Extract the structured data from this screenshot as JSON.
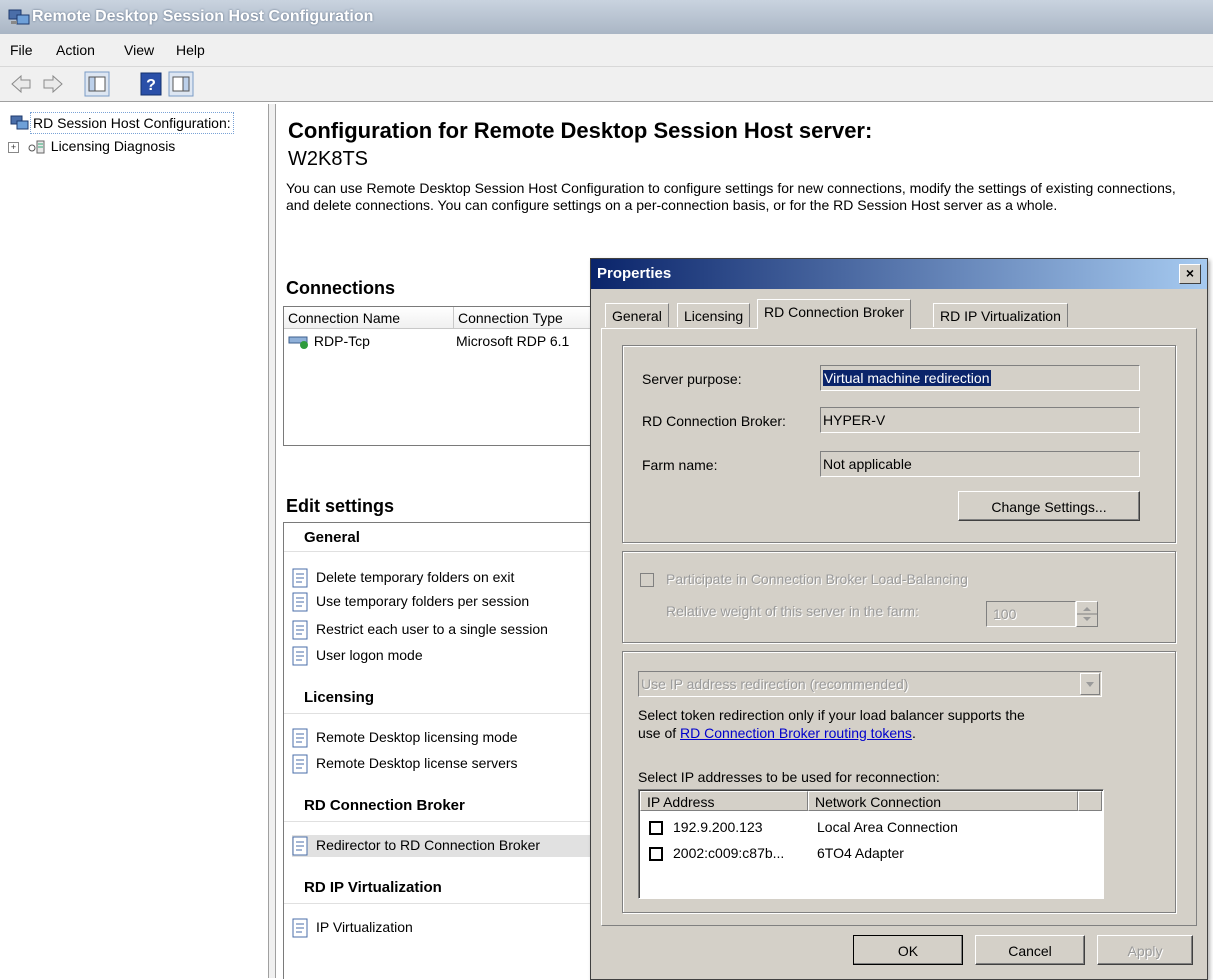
{
  "window": {
    "title": "Remote Desktop Session Host Configuration"
  },
  "menu": [
    "File",
    "Action",
    "View",
    "Help"
  ],
  "toolbar": [
    "back-arrow-icon",
    "forward-arrow-icon",
    "show-hide-tree-icon",
    "help-icon",
    "action-pane-icon"
  ],
  "tree": {
    "root": "RD Session Host Configuration:",
    "child": "Licensing Diagnosis"
  },
  "main": {
    "title": "Configuration for Remote Desktop Session Host server:",
    "server": "W2K8TS",
    "description": "You can use Remote Desktop Session Host Configuration to configure settings for new connections, modify the settings of existing connections, and delete connections. You can configure settings on a per-connection basis, or for the RD Session Host server as a whole.",
    "connections_heading": "Connections",
    "connections_columns": [
      "Connection Name",
      "Connection Type"
    ],
    "connections_rows": [
      {
        "name": "RDP-Tcp",
        "type": "Microsoft RDP 6.1"
      }
    ],
    "edit_heading": "Edit settings",
    "groups": [
      {
        "name": "General",
        "items": [
          "Delete temporary folders on exit",
          "Use temporary folders per session",
          "Restrict each user to a single session",
          "User logon mode"
        ]
      },
      {
        "name": "Licensing",
        "items": [
          "Remote Desktop licensing mode",
          "Remote Desktop license servers"
        ]
      },
      {
        "name": "RD Connection Broker",
        "items": [
          "Redirector to RD Connection Broker"
        ]
      },
      {
        "name": "RD IP Virtualization",
        "items": [
          "IP Virtualization"
        ]
      }
    ]
  },
  "dialog": {
    "title": "Properties",
    "close": "×",
    "tabs": [
      "General",
      "Licensing",
      "RD Connection Broker",
      "RD IP Virtualization"
    ],
    "active_tab": "RD Connection Broker",
    "server_purpose_label": "Server purpose:",
    "server_purpose_value": "Virtual machine redirection",
    "broker_label": "RD Connection Broker:",
    "broker_value": "HYPER-V",
    "farm_label": "Farm name:",
    "farm_value": "Not applicable",
    "change_settings": "Change Settings...",
    "load_balancing_label": "Participate in Connection Broker Load-Balancing",
    "weight_label": "Relative weight of this server in the farm:",
    "weight_value": "100",
    "redirection_select": "Use IP address redirection (recommended)",
    "token_text_1": "Select token redirection only if your load balancer supports the",
    "token_text_2": "use of",
    "token_link": "RD Connection Broker routing tokens",
    "token_text_3": ".",
    "ip_select_label": "Select IP addresses to be used for reconnection:",
    "ip_columns": [
      "IP Address",
      "Network Connection"
    ],
    "ip_rows": [
      {
        "ip": "192.9.200.123",
        "conn": "Local Area Connection"
      },
      {
        "ip": "2002:c009:c87b...",
        "conn": "6TO4 Adapter"
      }
    ],
    "ok": "OK",
    "cancel": "Cancel",
    "apply": "Apply"
  }
}
